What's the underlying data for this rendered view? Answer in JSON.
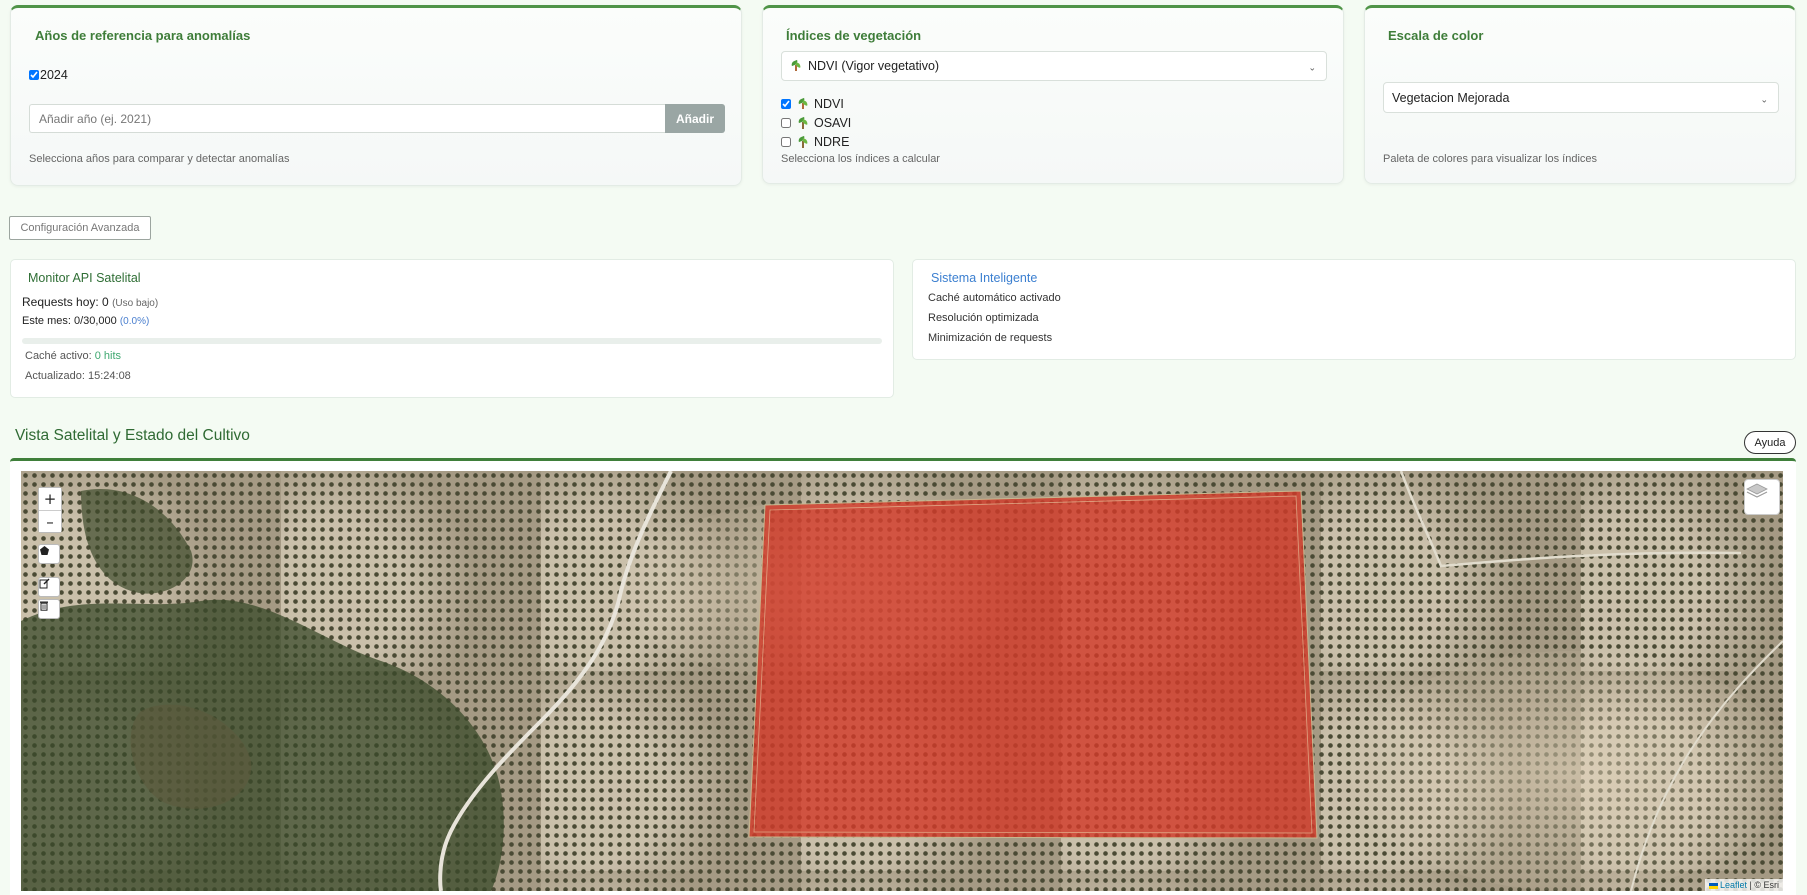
{
  "years_card": {
    "title": "Años de referencia para anomalías",
    "checked_years": [
      {
        "label": "2024",
        "checked": true
      }
    ],
    "input_placeholder": "Añadir año (ej. 2021)",
    "add_label": "Añadir",
    "hint": "Selecciona años para comparar y detectar anomalías"
  },
  "indices_card": {
    "title": "Índices de vegetación",
    "selected": "NDVI (Vigor vegetativo)",
    "options": [
      {
        "label": "NDVI",
        "checked": true,
        "icon": "seedling-icon"
      },
      {
        "label": "OSAVI",
        "checked": false,
        "icon": "herb-icon"
      },
      {
        "label": "NDRE",
        "checked": false,
        "icon": "leaf-icon"
      }
    ],
    "hint": "Selecciona los índices a calcular"
  },
  "color_card": {
    "title": "Escala de color",
    "selected": "Vegetacion Mejorada",
    "hint": "Paleta de colores para visualizar los índices"
  },
  "advanced_label": "Configuración Avanzada",
  "monitor": {
    "title": "Monitor API Satelital",
    "requests_label": "Requests hoy: 0",
    "requests_note": "(Uso bajo)",
    "month_label": "Este mes: 0/30,000",
    "month_pct": "(0.0%)",
    "usage_fraction": 0.0,
    "cache_label": "Caché activo:",
    "cache_value": "0 hits",
    "updated": "Actualizado: 15:24:08"
  },
  "sistema": {
    "title": "Sistema Inteligente",
    "lines": [
      "Caché automático activado",
      "Resolución optimizada",
      "Minimización de requests"
    ]
  },
  "map_section": {
    "title": "Vista Satelital y Estado del Cultivo",
    "help_label": "Ayuda",
    "zoom_in": "+",
    "zoom_out": "–",
    "attribution_link": "Leaflet",
    "attribution_text": "| © Esri",
    "parcel_color": "#d23a2a"
  },
  "colors": {
    "accent": "#4f9447",
    "title_green": "#3e7d39",
    "blue": "#3b7fd0"
  }
}
